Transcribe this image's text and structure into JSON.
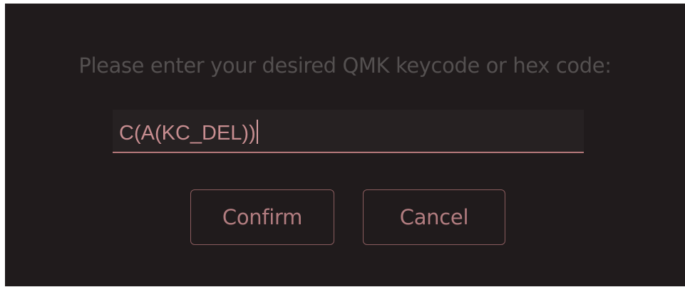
{
  "dialog": {
    "prompt": "Please enter your desired QMK keycode or hex code:",
    "input_value": "C(A(KC_DEL))",
    "confirm_label": "Confirm",
    "cancel_label": "Cancel"
  },
  "colors": {
    "background": "#201b1c",
    "accent": "#b4787a",
    "text_muted": "#545050"
  }
}
